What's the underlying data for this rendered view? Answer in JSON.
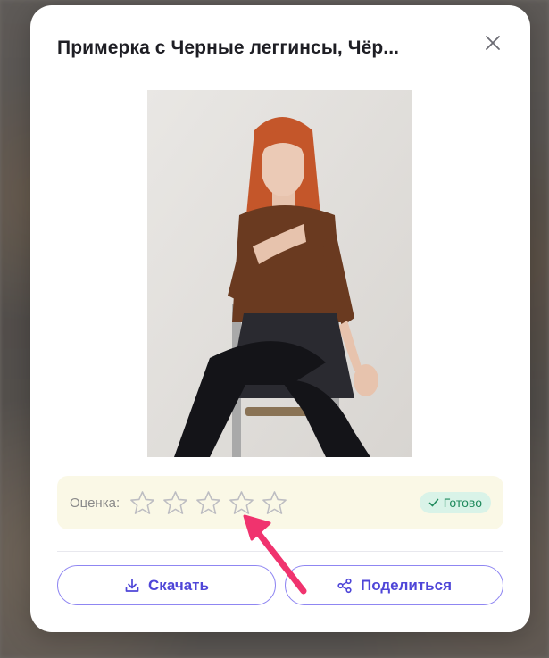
{
  "modal": {
    "title": "Примерка с Черные леггинсы, Чёр...",
    "close_icon": "close-icon"
  },
  "rating": {
    "label": "Оценка:",
    "stars_total": 5,
    "stars_filled": 0,
    "status_badge": "Готово",
    "status_color": "#1f8a5c"
  },
  "actions": {
    "download_label": "Скачать",
    "share_label": "Поделиться",
    "accent_color": "#4f46d8"
  },
  "annotation": {
    "arrow_color": "#f0336e"
  }
}
